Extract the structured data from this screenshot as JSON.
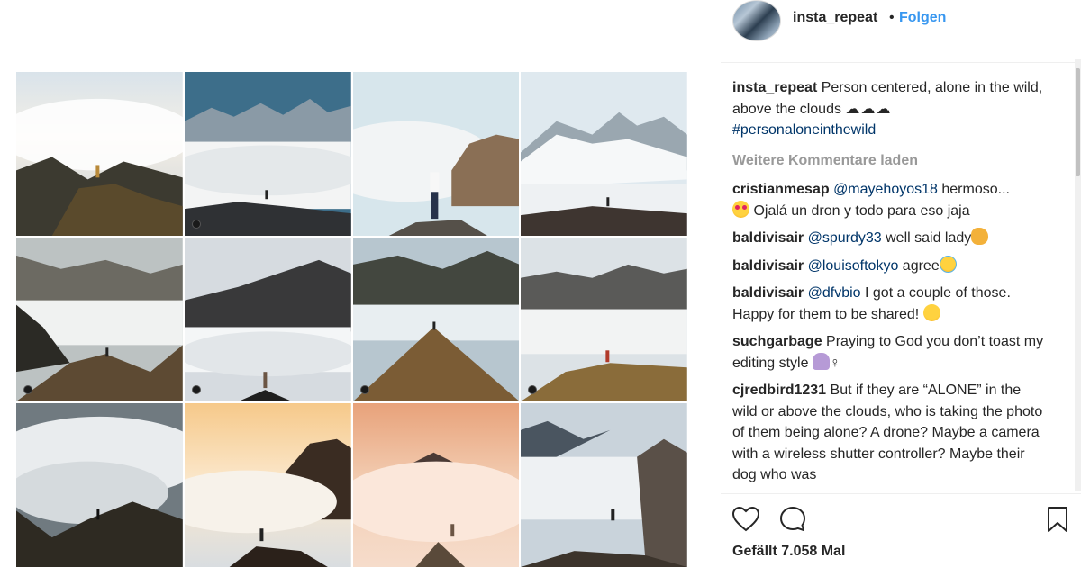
{
  "header": {
    "username": "insta_repeat",
    "separator": "•",
    "follow_label": "Folgen"
  },
  "caption": {
    "user": "insta_repeat",
    "text": "Person centered, alone in the wild, above the clouds",
    "cloud_emojis": "☁☁☁",
    "hashtag": "#personaloneinthewild"
  },
  "load_more_label": "Weitere Kommentare laden",
  "comments": [
    {
      "user": "cristianmesap",
      "mention": "@mayehoyos18",
      "text": "hermoso... ",
      "text2": "Ojalá un dron y todo para eso jaja"
    },
    {
      "user": "baldivisair",
      "mention": "@spurdy33",
      "text": "well said lady"
    },
    {
      "user": "baldivisair",
      "mention": "@louisoftokyo",
      "text": "agree"
    },
    {
      "user": "baldivisair",
      "mention": "@dfvbio",
      "text": "I got a couple of those. Happy for them to be shared!"
    },
    {
      "user": "suchgarbage",
      "text": "Praying to God you don’t toast my editing style",
      "suffix": "♀"
    },
    {
      "user": "cjredbird1231",
      "text": "But if they are “ALONE” in the wild or above the clouds, who is taking the photo of them being alone? A drone? Maybe a camera with a wireless shutter controller? Maybe their dog who was"
    }
  ],
  "likes_label": "Gefällt 7.058 Mal",
  "icons": {
    "like": "heart-outline-icon",
    "comment": "speech-bubble-icon",
    "save": "bookmark-icon",
    "tile_badge": "user-tag-icon"
  },
  "colors": {
    "link": "#003569",
    "follow": "#3897f0",
    "muted": "#999999"
  }
}
